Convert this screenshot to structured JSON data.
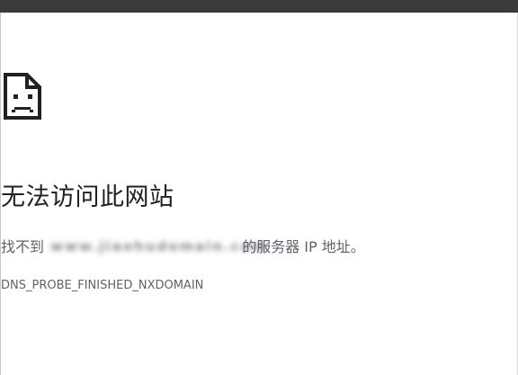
{
  "error_page": {
    "icon": "sad-page-icon",
    "title": "无法访问此网站",
    "message_prefix": "找不到",
    "domain_redacted": "www.jiaohudomain.com",
    "message_suffix": "的服务器 IP 地址。",
    "error_code": "DNS_PROBE_FINISHED_NXDOMAIN"
  },
  "colors": {
    "title": "#202124",
    "body_text": "#5f6368",
    "top_bar": "#3a3a3a",
    "background": "#ffffff"
  }
}
